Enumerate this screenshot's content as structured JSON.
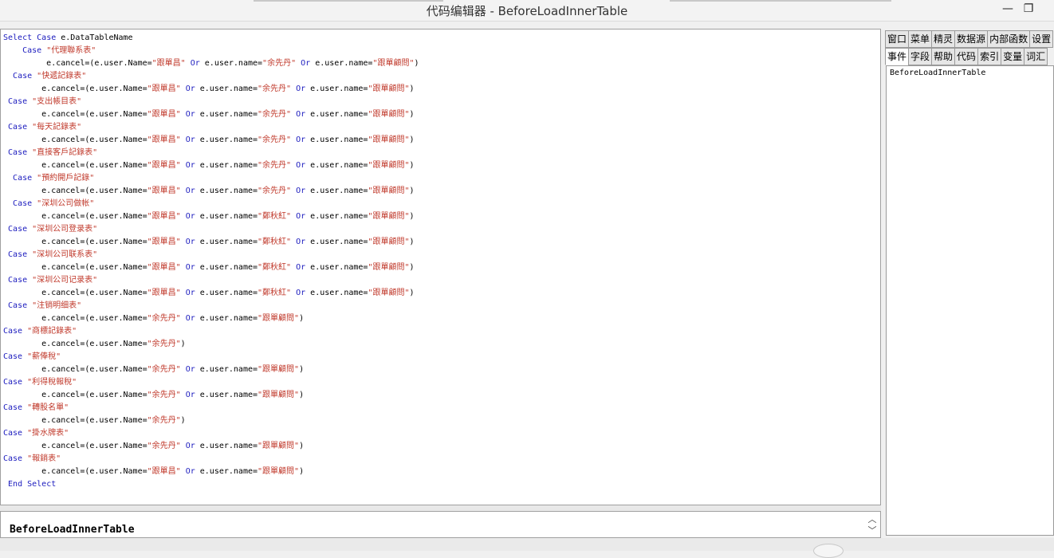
{
  "window": {
    "title": "代码编辑器 - BeforeLoadInnerTable",
    "minimize_glyph": "—",
    "restore_glyph": "❐"
  },
  "code_lines": [
    "Select Case e.DataTableName",
    "    Case \"代理聯系表\"",
    "         e.cancel=(e.user.Name=\"跟單昌\" Or e.user.name=\"余先丹\" Or e.user.name=\"跟單顧問\")",
    "  Case \"快遞記錄表\"",
    "        e.cancel=(e.user.Name=\"跟單昌\" Or e.user.name=\"余先丹\" Or e.user.name=\"跟單顧問\")",
    " Case \"支出帳目表\"",
    "        e.cancel=(e.user.Name=\"跟單昌\" Or e.user.name=\"余先丹\" Or e.user.name=\"跟單顧問\")",
    " Case \"每天記錄表\"",
    "        e.cancel=(e.user.Name=\"跟單昌\" Or e.user.name=\"余先丹\" Or e.user.name=\"跟單顧問\")",
    " Case \"直接客戶記錄表\"",
    "        e.cancel=(e.user.Name=\"跟單昌\" Or e.user.name=\"余先丹\" Or e.user.name=\"跟單顧問\")",
    "  Case \"預約開戶記錄\"",
    "        e.cancel=(e.user.Name=\"跟單昌\" Or e.user.name=\"余先丹\" Or e.user.name=\"跟單顧問\")",
    "  Case \"深圳公司做帐\"",
    "        e.cancel=(e.user.Name=\"跟單昌\" Or e.user.name=\"鄭秋紅\" Or e.user.name=\"跟單顧問\")",
    " Case \"深圳公司登录表\"",
    "        e.cancel=(e.user.Name=\"跟單昌\" Or e.user.name=\"鄭秋紅\" Or e.user.name=\"跟單顧問\")",
    " Case \"深圳公司联系表\"",
    "        e.cancel=(e.user.Name=\"跟單昌\" Or e.user.name=\"鄭秋紅\" Or e.user.name=\"跟單顧問\")",
    " Case \"深圳公司记录表\"",
    "        e.cancel=(e.user.Name=\"跟單昌\" Or e.user.name=\"鄭秋紅\" Or e.user.name=\"跟單顧問\")",
    " Case \"注销明细表\"",
    "        e.cancel=(e.user.Name=\"余先丹\" Or e.user.name=\"跟單顧問\")",
    "Case \"商標記錄表\"",
    "        e.cancel=(e.user.Name=\"余先丹\")",
    "Case \"薪俸稅\"",
    "        e.cancel=(e.user.Name=\"余先丹\" Or e.user.name=\"跟單顧問\")",
    "Case \"利得稅報稅\"",
    "        e.cancel=(e.user.Name=\"余先丹\" Or e.user.name=\"跟單顧問\")",
    "Case \"轉股名單\"",
    "        e.cancel=(e.user.Name=\"余先丹\")",
    "Case \"掛水牌表\"",
    "        e.cancel=(e.user.Name=\"余先丹\" Or e.user.name=\"跟單顧問\")",
    "Case \"報銷表\"",
    "        e.cancel=(e.user.Name=\"跟單昌\" Or e.user.name=\"跟單顧問\")",
    " End Select"
  ],
  "status": {
    "event_name": "BeforeLoadInnerTable",
    "up_glyph": "︿",
    "down_glyph": "﹀"
  },
  "right_panel": {
    "tabs_row1": [
      "窗口",
      "菜单",
      "精灵",
      "数据源",
      "内部函数",
      "设置"
    ],
    "tabs_row2": [
      "事件",
      "字段",
      "帮助",
      "代码",
      "索引",
      "变量",
      "词汇"
    ],
    "active_tab": "事件",
    "list_items": [
      "BeforeLoadInnerTable"
    ]
  },
  "colors": {
    "keyword": "#1b1bbe",
    "string": "#c0392b"
  }
}
